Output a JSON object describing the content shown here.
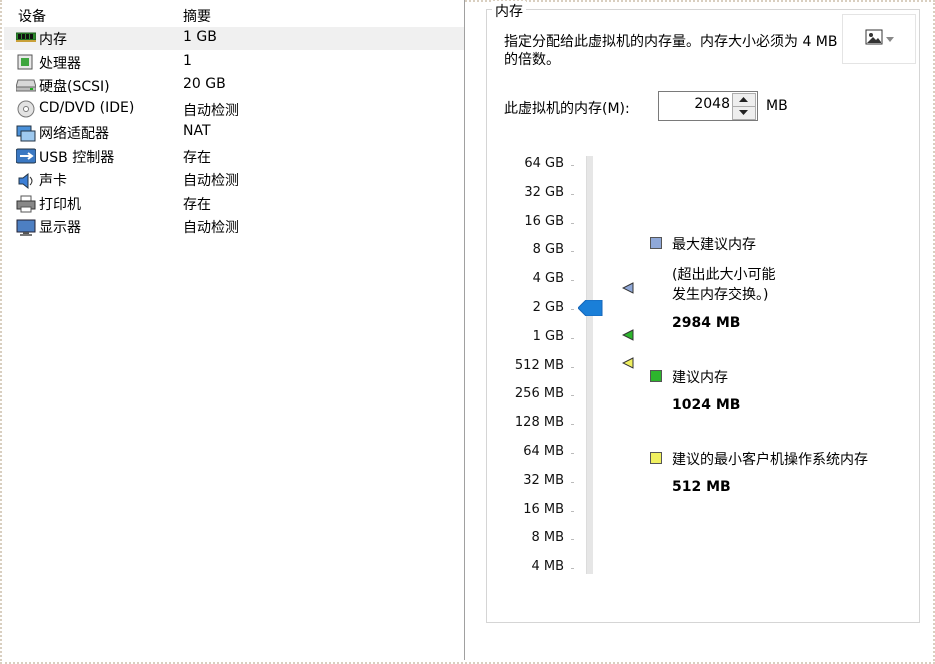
{
  "devices": {
    "header": {
      "device": "设备",
      "summary": "摘要"
    },
    "items": [
      {
        "name": "内存",
        "summary": "1 GB",
        "icon": "memory-icon"
      },
      {
        "name": "处理器",
        "summary": "1",
        "icon": "processor-icon"
      },
      {
        "name": "硬盘(SCSI)",
        "summary": "20 GB",
        "icon": "hard-disk-icon"
      },
      {
        "name": "CD/DVD (IDE)",
        "summary": "自动检测",
        "icon": "cd-dvd-icon"
      },
      {
        "name": "网络适配器",
        "summary": "NAT",
        "icon": "network-adapter-icon"
      },
      {
        "name": "USB 控制器",
        "summary": "存在",
        "icon": "usb-icon"
      },
      {
        "name": "声卡",
        "summary": "自动检测",
        "icon": "sound-card-icon"
      },
      {
        "name": "打印机",
        "summary": "存在",
        "icon": "printer-icon"
      },
      {
        "name": "显示器",
        "summary": "自动检测",
        "icon": "display-icon"
      }
    ]
  },
  "memory": {
    "group_title": "内存",
    "description": "指定分配给此虚拟机的内存量。内存大小必须为 4 MB 的倍数。",
    "label": "此虚拟机的内存(M):",
    "value": "2048",
    "unit": "MB",
    "scale_ticks": [
      "64 GB",
      "32 GB",
      "16 GB",
      "8 GB",
      "4 GB",
      "2 GB",
      "1 GB",
      "512 MB",
      "256 MB",
      "128 MB",
      "64 MB",
      "32 MB",
      "16 MB",
      "8 MB",
      "4 MB"
    ],
    "current_tick": "2 GB",
    "legend": {
      "max": {
        "title": "最大建议内存",
        "note1": "(超出此大小可能",
        "note2": "发生内存交换。)",
        "value": "2984 MB",
        "color": "#8fa8d8"
      },
      "recommended": {
        "title": "建议内存",
        "value": "1024 MB",
        "color": "#2db52d"
      },
      "min": {
        "title": "建议的最小客户机操作系统内存",
        "value": "512 MB",
        "color": "#f0f060"
      }
    }
  },
  "toolbar": {
    "image_btn_icon": "image-icon",
    "dropdown_icon": "chevron-down-icon"
  }
}
